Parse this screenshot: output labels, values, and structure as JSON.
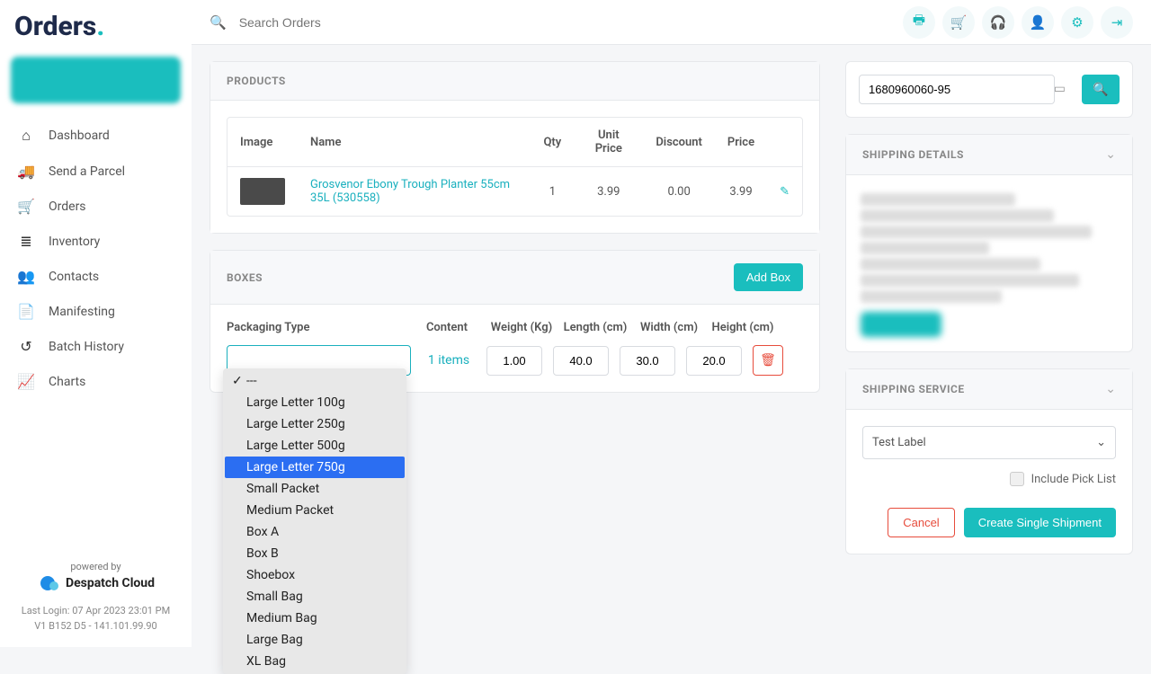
{
  "logo": {
    "text": "Orders"
  },
  "sidebar": {
    "items": [
      {
        "label": "Dashboard",
        "icon": "⌂"
      },
      {
        "label": "Send a Parcel",
        "icon": "🚚"
      },
      {
        "label": "Orders",
        "icon": "🛒"
      },
      {
        "label": "Inventory",
        "icon": "≣"
      },
      {
        "label": "Contacts",
        "icon": "👥"
      },
      {
        "label": "Manifesting",
        "icon": "📄"
      },
      {
        "label": "Batch History",
        "icon": "↺"
      },
      {
        "label": "Charts",
        "icon": "📈"
      }
    ],
    "powered_label": "powered by",
    "powered_brand": "Despatch Cloud",
    "footer_line1": "Last Login: 07 Apr 2023 23:01 PM",
    "footer_line2": "V1 B152 D5 - 141.101.99.90"
  },
  "search": {
    "placeholder": "Search Orders"
  },
  "products": {
    "title": "PRODUCTS",
    "headers": {
      "image": "Image",
      "name": "Name",
      "qty": "Qty",
      "unit_price": "Unit Price",
      "discount": "Discount",
      "price": "Price"
    },
    "rows": [
      {
        "name": "Grosvenor Ebony Trough Planter 55cm 35L (530558)",
        "qty": "1",
        "unit_price": "3.99",
        "discount": "0.00",
        "price": "3.99"
      }
    ]
  },
  "boxes": {
    "title": "BOXES",
    "add_label": "Add Box",
    "headers": {
      "pkg": "Packaging Type",
      "content": "Content",
      "weight": "Weight (Kg)",
      "length": "Length (cm)",
      "width": "Width (cm)",
      "height": "Height (cm)"
    },
    "row": {
      "content": "1 items",
      "weight": "1.00",
      "length": "40.0",
      "width": "30.0",
      "height": "20.0"
    },
    "options": [
      "---",
      "Large Letter 100g",
      "Large Letter 250g",
      "Large Letter 500g",
      "Large Letter 750g",
      "Small Packet",
      "Medium Packet",
      "Box A",
      "Box B",
      "Shoebox",
      "Small Bag",
      "Medium Bag",
      "Large Bag",
      "XL Bag"
    ],
    "selected_index": 0,
    "highlight_index": 4
  },
  "right": {
    "search_value": "1680960060-95",
    "shipping_details_title": "SHIPPING DETAILS",
    "shipping_service_title": "SHIPPING SERVICE",
    "service_value": "Test Label",
    "include_pick_label": "Include Pick List",
    "cancel_label": "Cancel",
    "create_label": "Create Single Shipment"
  }
}
